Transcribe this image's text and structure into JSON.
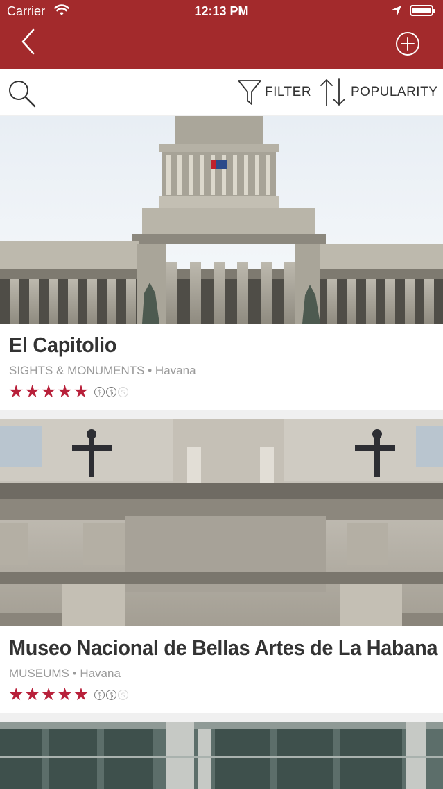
{
  "status_bar": {
    "carrier": "Carrier",
    "time": "12:13 PM"
  },
  "nav": {
    "back_icon": "chevron-left-icon",
    "add_icon": "plus-circle-icon"
  },
  "toolbar": {
    "filter_label": "FILTER",
    "sort_label": "POPULARITY"
  },
  "colors": {
    "brand": "#a32a2c",
    "star": "#b8203a"
  },
  "places": [
    {
      "title": "El Capitolio",
      "category": "SIGHTS & MONUMENTS",
      "separator": " • ",
      "city": "Havana",
      "rating": 5,
      "price_level": 2,
      "price_max": 3
    },
    {
      "title": "Museo Nacional de Bellas Artes de La Habana",
      "category": "MUSEUMS",
      "separator": " • ",
      "city": "Havana",
      "rating": 5,
      "price_level": 2,
      "price_max": 3
    }
  ]
}
